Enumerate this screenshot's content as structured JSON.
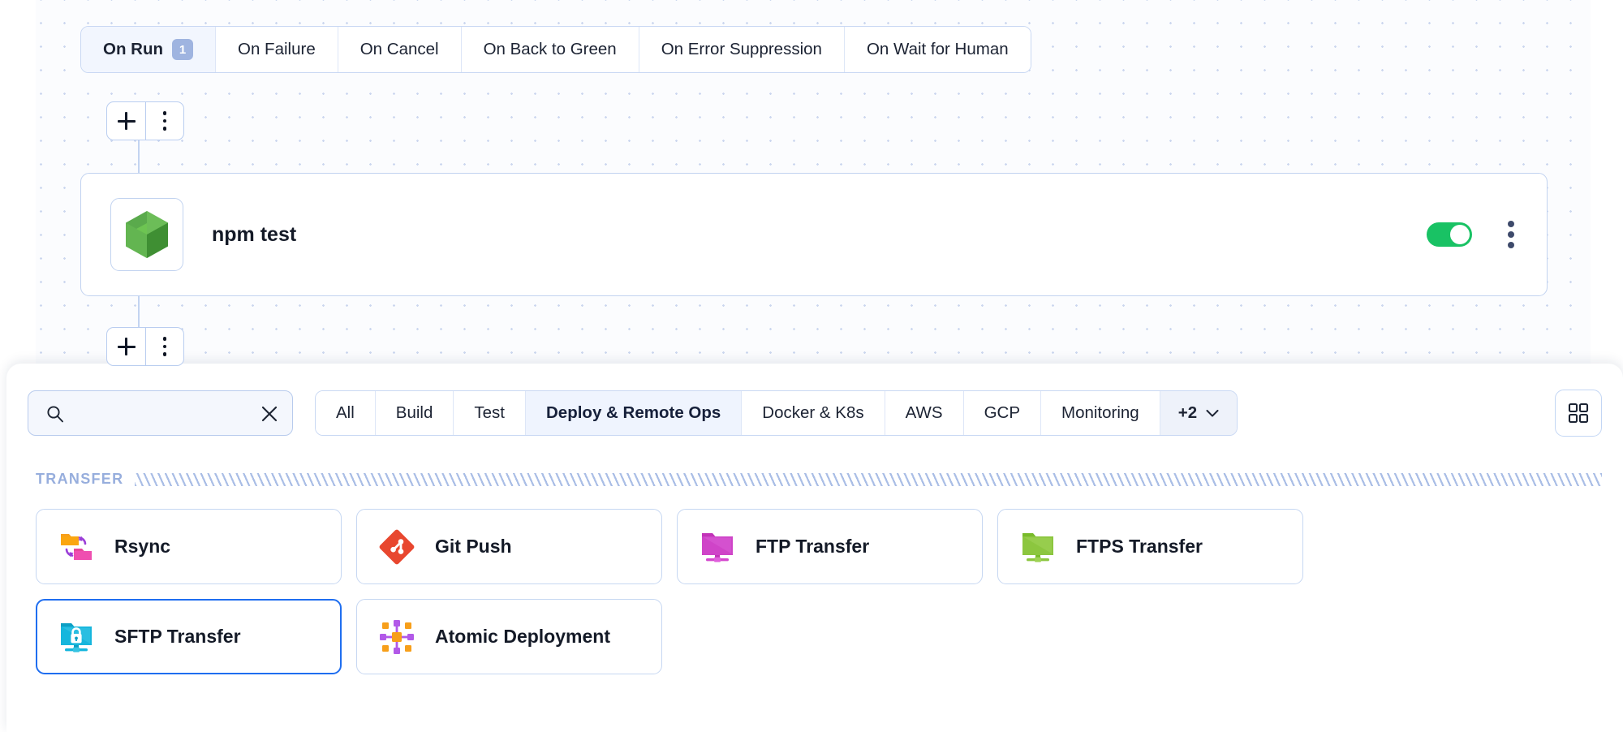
{
  "canvas": {
    "trigger_tabs": [
      {
        "label": "On Run",
        "badge": "1",
        "active": true
      },
      {
        "label": "On Failure",
        "badge": "",
        "active": false
      },
      {
        "label": "On Cancel",
        "badge": "",
        "active": false
      },
      {
        "label": "On Back to Green",
        "badge": "",
        "active": false
      },
      {
        "label": "On Error Suppression",
        "badge": "",
        "active": false
      },
      {
        "label": "On Wait for Human",
        "badge": "",
        "active": false
      }
    ],
    "action_node": {
      "title": "npm test",
      "icon": "nodejs-hexagon-icon",
      "enabled_toggle": "on",
      "menu_icon": "kebab-menu-icon"
    },
    "add_buttons": [
      {
        "plus": "plus-icon",
        "menu": "kebab-menu-icon"
      },
      {
        "plus": "plus-icon",
        "menu": "kebab-menu-icon"
      }
    ]
  },
  "panel": {
    "search": {
      "value": "",
      "placeholder": "",
      "search_icon": "search-icon",
      "clear_icon": "close-icon"
    },
    "filter_tabs": [
      {
        "label": "All",
        "active": false
      },
      {
        "label": "Build",
        "active": false
      },
      {
        "label": "Test",
        "active": false
      },
      {
        "label": "Deploy & Remote Ops",
        "active": true
      },
      {
        "label": "Docker & K8s",
        "active": false
      },
      {
        "label": "AWS",
        "active": false
      },
      {
        "label": "GCP",
        "active": false
      },
      {
        "label": "Monitoring",
        "active": false
      }
    ],
    "more_tab": {
      "label": "+2",
      "icon": "chevron-down-icon"
    },
    "grid_view_button": {
      "icon": "grid-view-icon"
    },
    "sections": [
      {
        "title": "TRANSFER",
        "items": [
          {
            "label": "Rsync",
            "icon": "rsync-folders-sync-icon",
            "selected": false
          },
          {
            "label": "Git Push",
            "icon": "git-icon",
            "selected": false
          },
          {
            "label": "FTP Transfer",
            "icon": "ftp-folder-icon",
            "selected": false
          },
          {
            "label": "FTPS Transfer",
            "icon": "ftps-folder-icon",
            "selected": false
          },
          {
            "label": "SFTP Transfer",
            "icon": "sftp-folder-lock-icon",
            "selected": true
          },
          {
            "label": "Atomic Deployment",
            "icon": "atomic-deployment-icon",
            "selected": false
          }
        ]
      }
    ]
  },
  "colors": {
    "accent": "#1f6ef0",
    "toggle_on": "#19c264",
    "border": "#c6d7f2",
    "section_label": "#97aedd"
  }
}
